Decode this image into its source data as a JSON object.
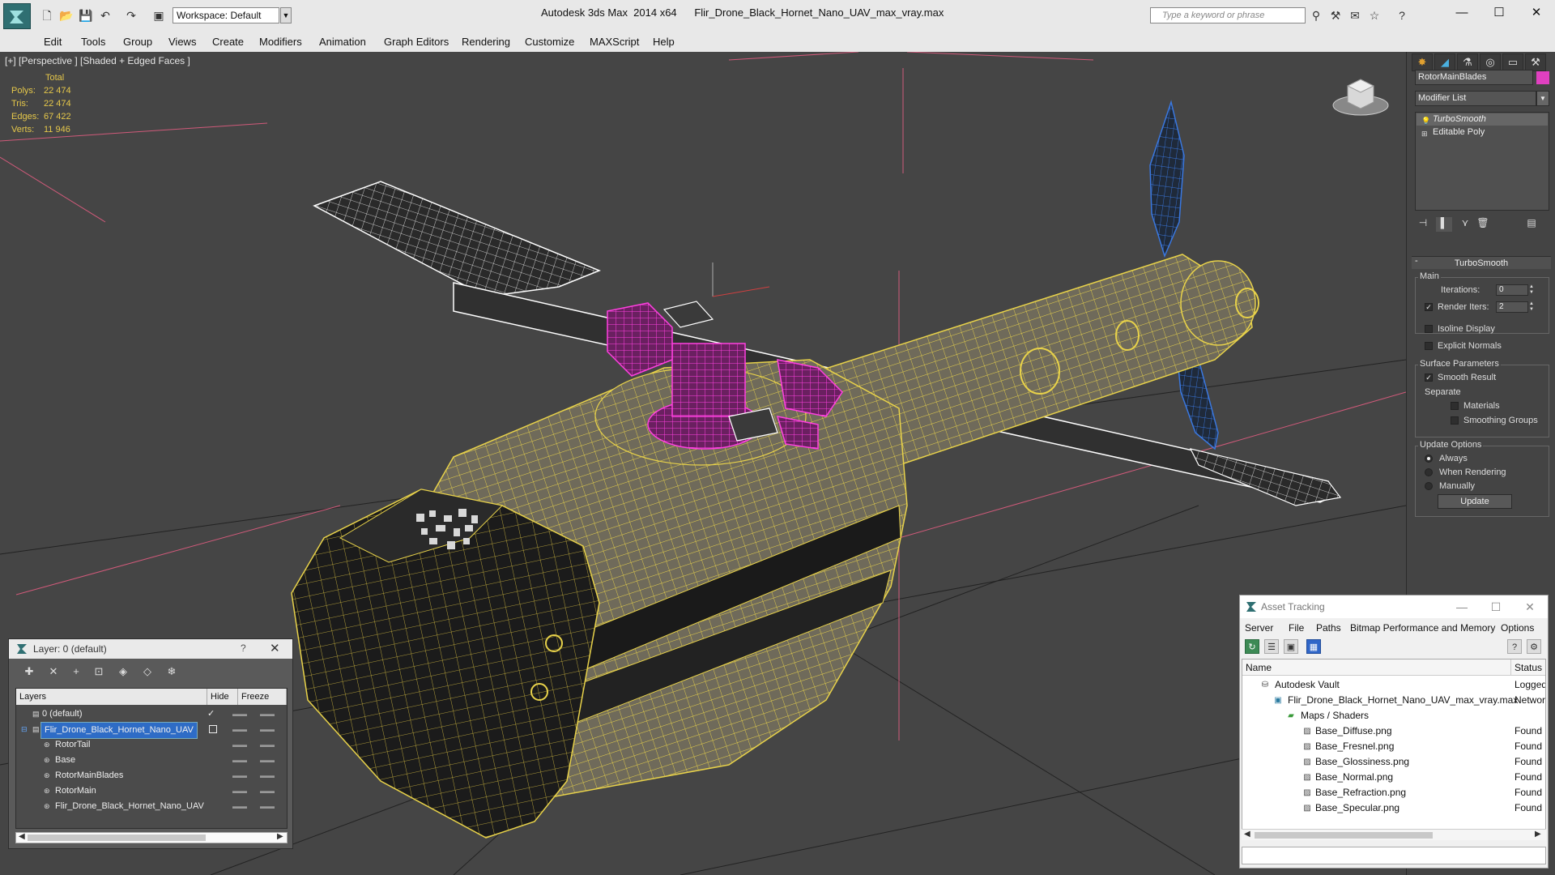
{
  "titlebar": {
    "workspace": "Workspace: Default",
    "window_title": "Autodesk 3ds Max  2014 x64      Flir_Drone_Black_Hornet_Nano_UAV_max_vray.max",
    "search_placeholder": "Type a keyword or phrase"
  },
  "menu": [
    "Edit",
    "Tools",
    "Group",
    "Views",
    "Create",
    "Modifiers",
    "Animation",
    "Graph Editors",
    "Rendering",
    "Customize",
    "MAXScript",
    "Help"
  ],
  "viewport": {
    "label": "[+] [Perspective ] [Shaded + Edged Faces ]",
    "stats": {
      "header": "Total",
      "rows": [
        {
          "key": "Polys:",
          "value": "22 474"
        },
        {
          "key": "Tris:",
          "value": "22 474"
        },
        {
          "key": "Edges:",
          "value": "67 422"
        },
        {
          "key": "Verts:",
          "value": "11 946"
        }
      ]
    }
  },
  "command_panel": {
    "object_name": "RotorMainBlades",
    "object_color": "#e040c0",
    "modifier_list": "Modifier List",
    "stack": [
      "TurboSmooth",
      "Editable Poly"
    ],
    "rollout_title": "TurboSmooth",
    "main_group": "Main",
    "iterations_label": "Iterations:",
    "iterations_value": "0",
    "render_iters_label": "Render Iters:",
    "render_iters_value": "2",
    "isoline_display": "Isoline Display",
    "explicit_normals": "Explicit Normals",
    "surface_group": "Surface Parameters",
    "smooth_result": "Smooth Result",
    "separate_label": "Separate",
    "materials": "Materials",
    "smoothing_groups": "Smoothing Groups",
    "update_group": "Update Options",
    "always": "Always",
    "when_rendering": "When Rendering",
    "manually": "Manually",
    "update_button": "Update"
  },
  "layer_dialog": {
    "title": "Layer: 0 (default)",
    "help": "?",
    "columns": [
      "Layers",
      "Hide",
      "Freeze"
    ],
    "rows": [
      {
        "name": "0 (default)",
        "indent": 0
      },
      {
        "name": "Flir_Drone_Black_Hornet_Nano_UAV",
        "indent": 0
      },
      {
        "name": "RotorTail",
        "indent": 1
      },
      {
        "name": "Base",
        "indent": 1
      },
      {
        "name": "RotorMainBlades",
        "indent": 1
      },
      {
        "name": "RotorMain",
        "indent": 1
      },
      {
        "name": "Flir_Drone_Black_Hornet_Nano_UAV",
        "indent": 1
      }
    ]
  },
  "asset_tracking": {
    "title": "Asset Tracking",
    "menu": [
      "Server",
      "File",
      "Paths",
      "Bitmap Performance and Memory",
      "Options"
    ],
    "columns": [
      "Name",
      "Status"
    ],
    "rows": [
      {
        "name": "Autodesk Vault",
        "status": "Logged",
        "indent": 1
      },
      {
        "name": "Flir_Drone_Black_Hornet_Nano_UAV_max_vray.max",
        "status": "Networ",
        "indent": 2
      },
      {
        "name": "Maps / Shaders",
        "status": "",
        "indent": 3
      },
      {
        "name": "Base_Diffuse.png",
        "status": "Found",
        "indent": 4
      },
      {
        "name": "Base_Fresnel.png",
        "status": "Found",
        "indent": 4
      },
      {
        "name": "Base_Glossiness.png",
        "status": "Found",
        "indent": 4
      },
      {
        "name": "Base_Normal.png",
        "status": "Found",
        "indent": 4
      },
      {
        "name": "Base_Refraction.png",
        "status": "Found",
        "indent": 4
      },
      {
        "name": "Base_Specular.png",
        "status": "Found",
        "indent": 4
      }
    ]
  }
}
